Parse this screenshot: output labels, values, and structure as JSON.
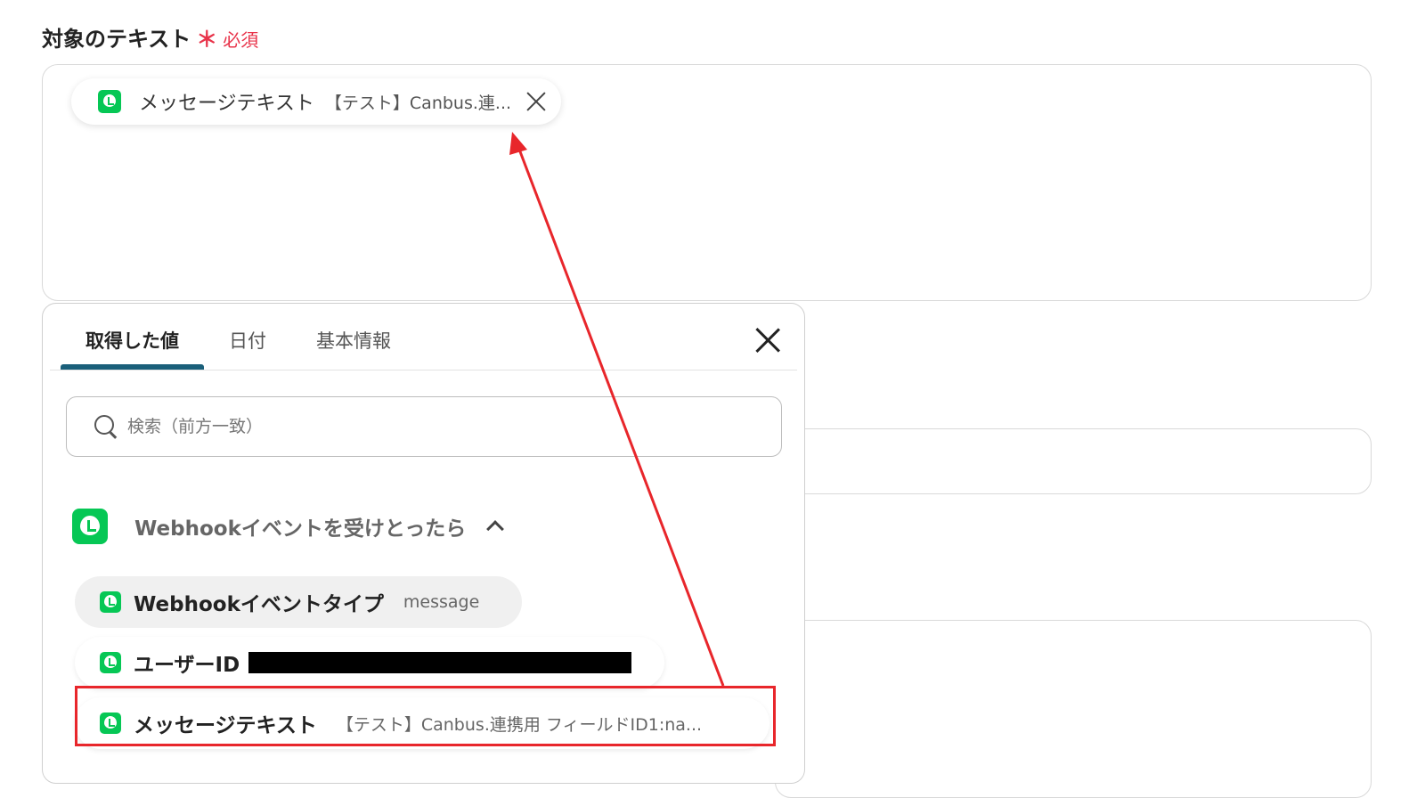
{
  "field": {
    "label": "対象のテキスト",
    "required_mark": "＊",
    "required_text": "必須"
  },
  "chip": {
    "name": "メッセージテキスト",
    "value": "【テスト】Canbus.連..."
  },
  "panel": {
    "tabs": [
      {
        "label": "取得した値",
        "active": true
      },
      {
        "label": "日付",
        "active": false
      },
      {
        "label": "基本情報",
        "active": false
      }
    ],
    "search": {
      "placeholder": "検索（前方一致）",
      "value": ""
    },
    "section": {
      "title": "Webhookイベントを受けとったら"
    },
    "items": [
      {
        "name": "Webhookイベントタイプ",
        "value": "message"
      },
      {
        "name": "ユーザーID",
        "value": ""
      },
      {
        "name": "メッセージテキスト",
        "value": "【テスト】Canbus.連携用 フィールドID1:na..."
      }
    ]
  },
  "colors": {
    "brand_green": "#06c755",
    "required_red": "#e8334a",
    "annotation_red": "#e8262b",
    "tab_indicator": "#1a5f7a"
  }
}
